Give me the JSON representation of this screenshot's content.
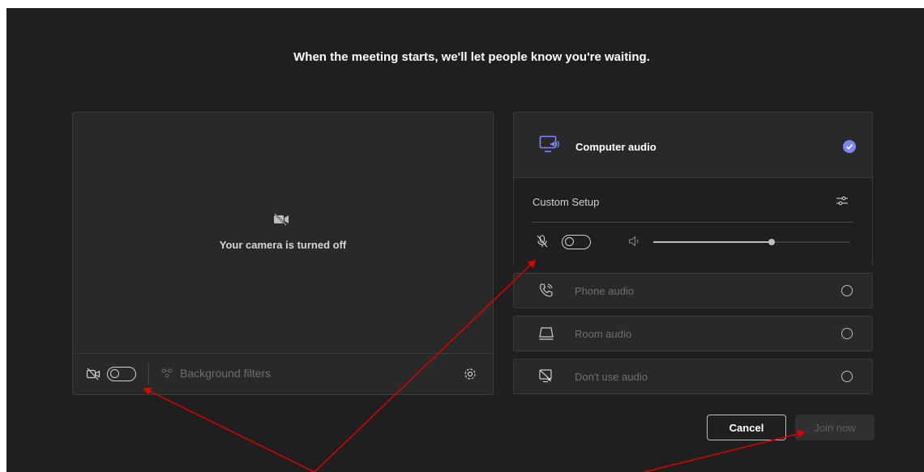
{
  "status_message": "When the meeting starts, we'll let people know you're waiting.",
  "camera": {
    "off_text": "Your camera is turned off",
    "toggle_on": false,
    "background_filters_label": "Background filters"
  },
  "audio": {
    "computer_audio_label": "Computer audio",
    "computer_audio_selected": true,
    "custom_setup_label": "Custom Setup",
    "mic_toggle_on": false,
    "speaker_volume": 0.6,
    "options": [
      {
        "label": "Phone audio",
        "icon": "phone-icon",
        "selected": false
      },
      {
        "label": "Room audio",
        "icon": "room-audio-icon",
        "selected": false
      },
      {
        "label": "Don't use audio",
        "icon": "no-audio-icon",
        "selected": false
      }
    ]
  },
  "buttons": {
    "cancel_label": "Cancel",
    "join_label": "Join now"
  },
  "colors": {
    "background": "#1f1f1f",
    "accent": "#7f85f5",
    "annotation_arrow": "#e00000"
  }
}
